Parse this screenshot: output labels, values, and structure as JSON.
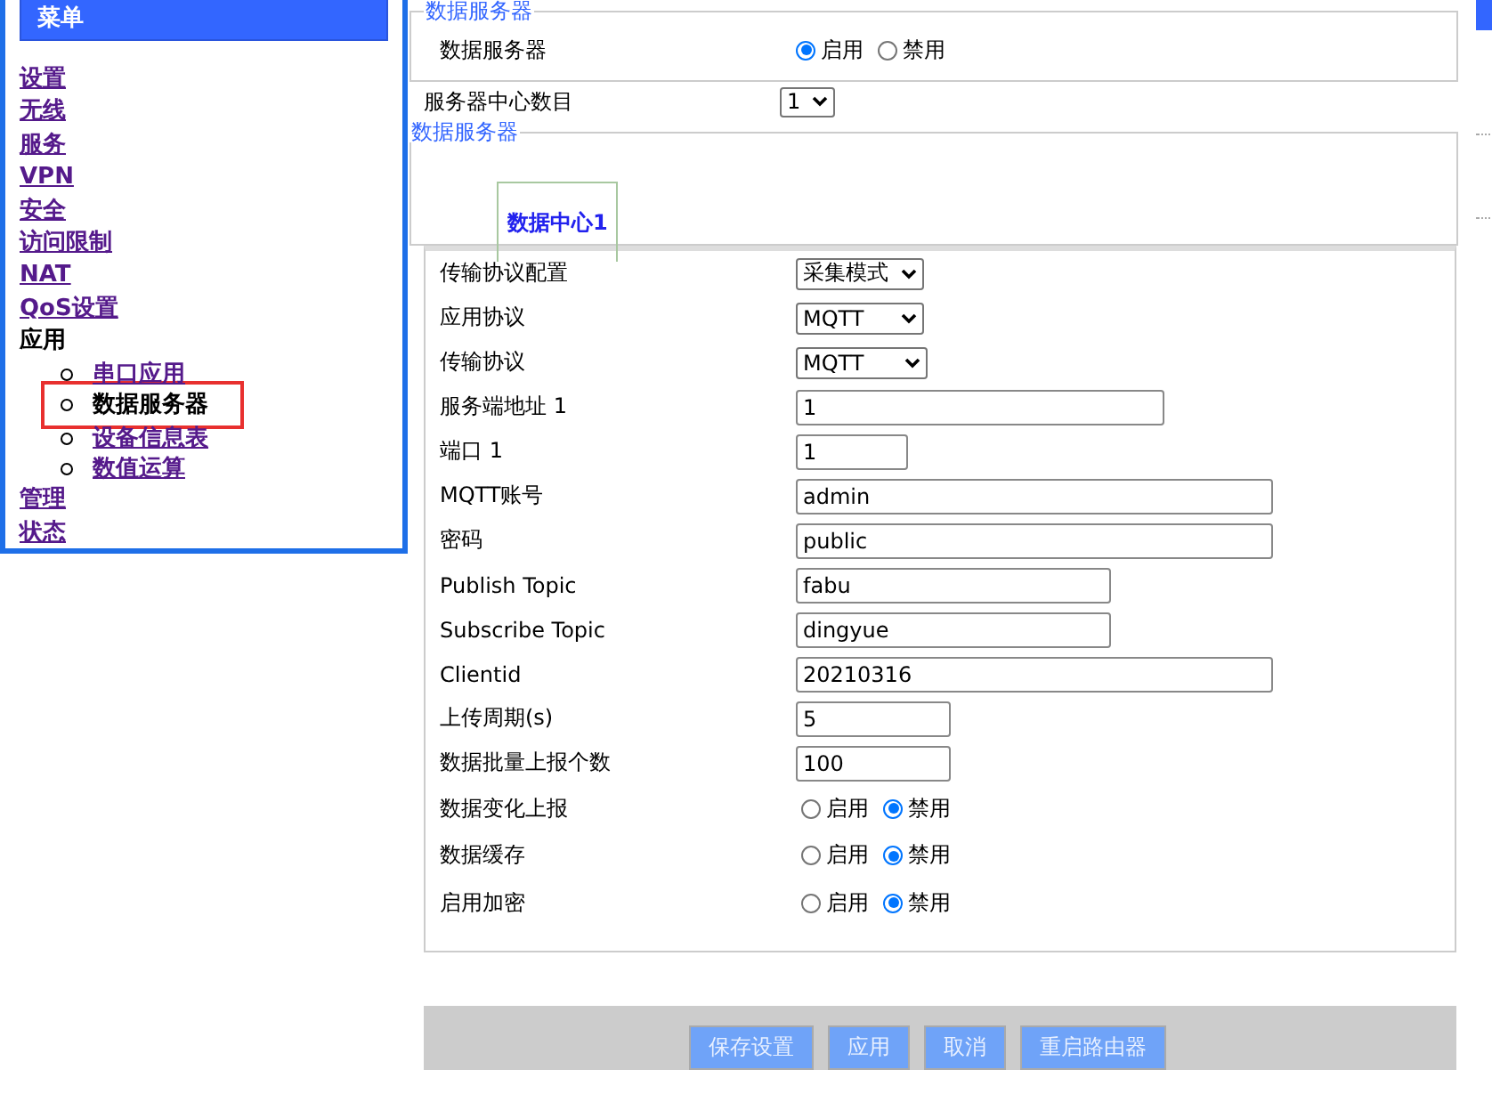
{
  "sidebar": {
    "title": "菜单",
    "items": [
      {
        "label": "设置",
        "kind": "link"
      },
      {
        "label": "无线",
        "kind": "link"
      },
      {
        "label": "服务",
        "kind": "link"
      },
      {
        "label": "VPN",
        "kind": "link"
      },
      {
        "label": "安全",
        "kind": "link"
      },
      {
        "label": "访问限制",
        "kind": "link"
      },
      {
        "label": "NAT",
        "kind": "link"
      },
      {
        "label": "QoS设置",
        "kind": "link"
      },
      {
        "label": "应用",
        "kind": "group",
        "children": [
          {
            "label": "串口应用",
            "selected": false
          },
          {
            "label": "数据服务器",
            "selected": true
          },
          {
            "label": "设备信息表",
            "selected": false
          },
          {
            "label": "数值运算",
            "selected": false
          }
        ]
      },
      {
        "label": "管理",
        "kind": "link"
      },
      {
        "label": "状态",
        "kind": "link"
      }
    ]
  },
  "server_section": {
    "legend": "数据服务器",
    "label": "数据服务器",
    "options": [
      {
        "label": "启用",
        "selected": true
      },
      {
        "label": "禁用",
        "selected": false
      }
    ]
  },
  "center_count": {
    "label": "服务器中心数目",
    "value": "1"
  },
  "centers_section": {
    "legend": "数据服务器",
    "tabs": [
      {
        "label": "数据中心1",
        "selected": true
      }
    ]
  },
  "form_rows": [
    {
      "kind": "select",
      "label": "传输协议配置",
      "value": "采集模式"
    },
    {
      "kind": "select",
      "label": "应用协议",
      "value": "MQTT"
    },
    {
      "kind": "select",
      "label": "传输协议",
      "value": "MQTT"
    },
    {
      "kind": "text",
      "label": "服务端地址 1",
      "value": "1"
    },
    {
      "kind": "text",
      "label": "端口 1",
      "value": "1"
    },
    {
      "kind": "text",
      "label": "MQTT账号",
      "value": "admin"
    },
    {
      "kind": "text",
      "label": "密码",
      "value": "public"
    },
    {
      "kind": "text",
      "label": "Publish Topic",
      "value": "fabu"
    },
    {
      "kind": "text",
      "label": "Subscribe Topic",
      "value": "dingyue"
    },
    {
      "kind": "text",
      "label": "Clientid",
      "value": "20210316"
    },
    {
      "kind": "text",
      "label": "上传周期(s)",
      "value": "5"
    },
    {
      "kind": "text",
      "label": "数据批量上报个数",
      "value": "100"
    },
    {
      "kind": "radio",
      "label": "数据变化上报",
      "options": [
        {
          "label": "启用",
          "selected": false
        },
        {
          "label": "禁用",
          "selected": true
        }
      ]
    },
    {
      "kind": "radio",
      "label": "数据缓存",
      "options": [
        {
          "label": "启用",
          "selected": false
        },
        {
          "label": "禁用",
          "selected": true
        }
      ]
    },
    {
      "kind": "radio",
      "label": "启用加密",
      "options": [
        {
          "label": "启用",
          "selected": false
        },
        {
          "label": "禁用",
          "selected": true
        }
      ]
    }
  ],
  "buttons": [
    "保存设置",
    "应用",
    "取消",
    "重启路由器"
  ]
}
